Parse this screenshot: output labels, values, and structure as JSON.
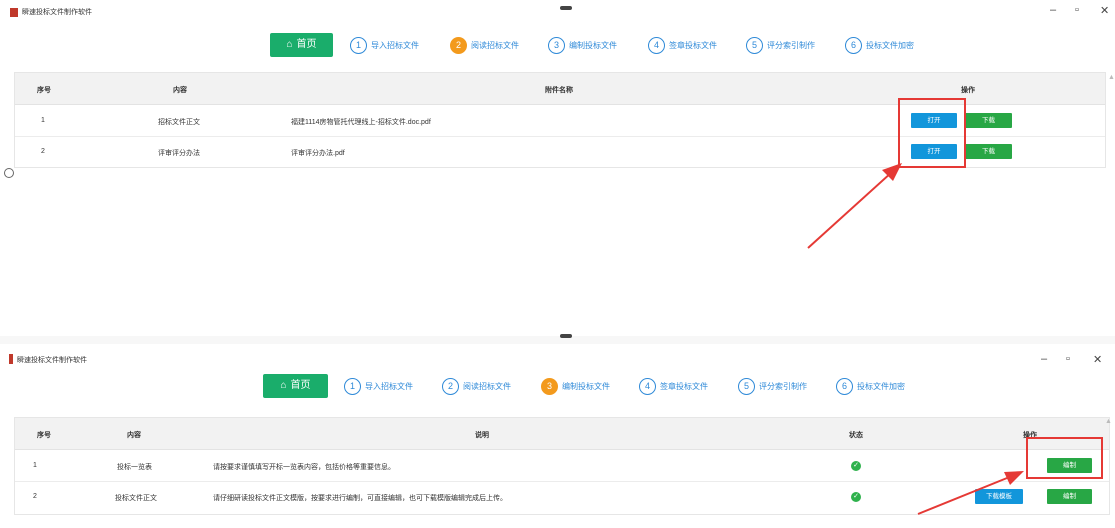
{
  "app_title": "瞬速投标文件制作软件",
  "window_controls": {
    "minimize": "–",
    "restore": "▫",
    "close": "✕"
  },
  "nav": {
    "home": "首页",
    "steps": [
      {
        "num": "1",
        "label": "导入招标文件"
      },
      {
        "num": "2",
        "label": "阅读招标文件"
      },
      {
        "num": "3",
        "label": "编制投标文件"
      },
      {
        "num": "4",
        "label": "签章投标文件"
      },
      {
        "num": "5",
        "label": "评分索引制作"
      },
      {
        "num": "6",
        "label": "投标文件加密"
      }
    ]
  },
  "screen1": {
    "active_step": "2",
    "columns": {
      "index": "序号",
      "content": "内容",
      "attachment": "附件名称",
      "actions": "操作"
    },
    "rows": [
      {
        "index": "1",
        "content": "招标文件正文",
        "attachment": "福建1114房物管托代理线上-招标文件.doc.pdf",
        "open": "打开",
        "download": "下载"
      },
      {
        "index": "2",
        "content": "评审评分办法",
        "attachment": "评审评分办法.pdf",
        "open": "打开",
        "download": "下载"
      }
    ]
  },
  "screen2": {
    "active_step": "3",
    "columns": {
      "index": "序号",
      "content": "内容",
      "description": "说明",
      "status": "状态",
      "actions": "操作"
    },
    "rows": [
      {
        "index": "1",
        "content": "投标一览表",
        "description": "请按要求谨慎填写开标一览表内容，包括价格等重要信息。",
        "status": "done",
        "edit": "编制"
      },
      {
        "index": "2",
        "content": "投标文件正文",
        "description": "请仔细研读投标文件正文模版，按要求进行编制，可直接编辑，也可下载模版编辑完成后上传。",
        "status": "done",
        "download_template": "下载模板",
        "edit": "编制"
      }
    ]
  },
  "icons": {
    "home": "house-icon",
    "status": "check-circle-icon"
  },
  "colors": {
    "home_green": "#1aad6b",
    "step_blue": "#2f8ad8",
    "active_orange": "#f39a1d",
    "open_blue": "#1296db",
    "action_green": "#28a745",
    "highlight_red": "#e53935"
  }
}
